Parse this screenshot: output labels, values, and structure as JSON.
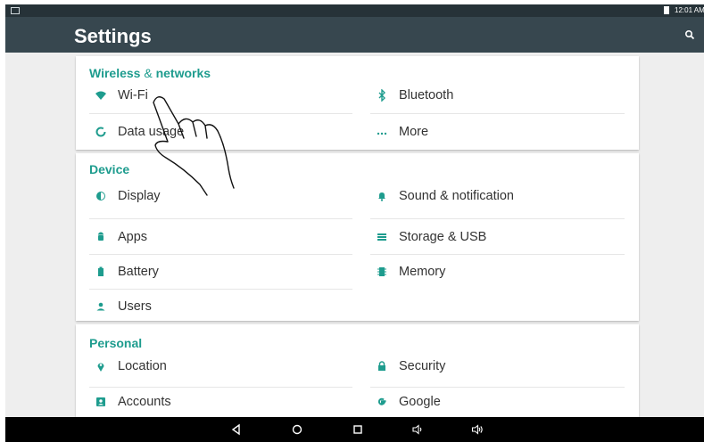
{
  "status_bar": {
    "time": "12:01 AM"
  },
  "app_bar": {
    "title": "Settings"
  },
  "sections": [
    {
      "header_main": "Wireless",
      "header_amp": "&",
      "header_rest": "networks",
      "items": [
        {
          "label": "Wi-Fi",
          "icon": "wifi-icon"
        },
        {
          "label": "Bluetooth",
          "icon": "bluetooth-icon"
        },
        {
          "label": "Data usage",
          "icon": "data-usage-icon"
        },
        {
          "label": "More",
          "icon": "more-icon"
        }
      ]
    },
    {
      "header": "Device",
      "items": [
        {
          "label": "Display",
          "icon": "display-icon"
        },
        {
          "label": "Sound & notification",
          "icon": "bell-icon"
        },
        {
          "label": "Apps",
          "icon": "android-icon"
        },
        {
          "label": "Storage & USB",
          "icon": "storage-icon"
        },
        {
          "label": "Battery",
          "icon": "battery-icon"
        },
        {
          "label": "Memory",
          "icon": "memory-icon"
        },
        {
          "label": "Users",
          "icon": "user-icon"
        }
      ]
    },
    {
      "header": "Personal",
      "items": [
        {
          "label": "Location",
          "icon": "location-icon"
        },
        {
          "label": "Security",
          "icon": "lock-icon"
        },
        {
          "label": "Accounts",
          "icon": "accounts-icon"
        },
        {
          "label": "Google",
          "icon": "google-icon"
        }
      ]
    }
  ],
  "colors": {
    "accent": "#1e9c8e",
    "appbar": "#37474f",
    "statusbar": "#263238",
    "background": "#eeeeee"
  },
  "nav_icons": [
    "back-icon",
    "home-icon",
    "recents-icon",
    "volume-down-icon",
    "volume-up-icon"
  ]
}
